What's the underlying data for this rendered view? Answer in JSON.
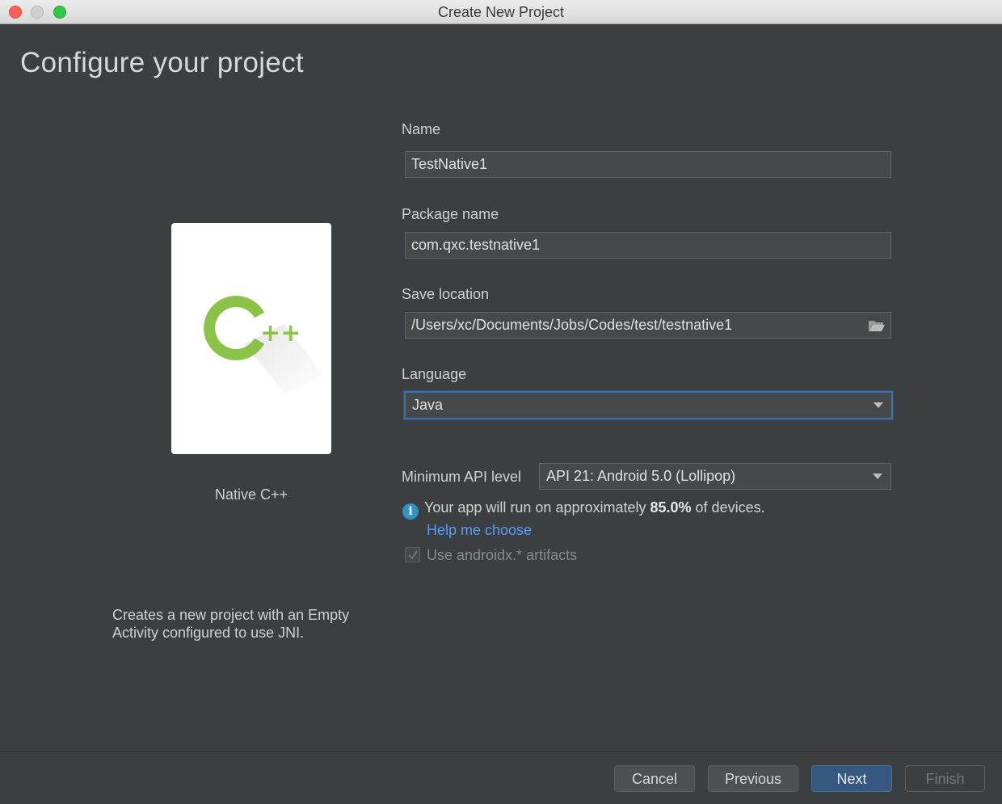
{
  "window": {
    "title": "Create New Project"
  },
  "page": {
    "title": "Configure your project"
  },
  "template": {
    "name": "Native C++",
    "description": "Creates a new project with an Empty Activity configured to use JNI.",
    "logo_text": "C++",
    "logo_color": "#8bc34a"
  },
  "form": {
    "name_label": "Name",
    "name_value": "TestNative1",
    "package_label": "Package name",
    "package_value": "com.qxc.testnative1",
    "location_label": "Save location",
    "location_value": "/Users/xc/Documents/Jobs/Codes/test/testnative1",
    "language_label": "Language",
    "language_value": "Java",
    "min_api_label": "Minimum API level",
    "min_api_value": "API 21: Android 5.0 (Lollipop)",
    "info_prefix": "Your app will run on approximately ",
    "info_percent": "85.0%",
    "info_suffix": " of devices.",
    "help_link": "Help me choose",
    "androidx_label": "Use androidx.* artifacts",
    "androidx_checked": true
  },
  "buttons": {
    "cancel": "Cancel",
    "previous": "Previous",
    "next": "Next",
    "finish": "Finish"
  },
  "colors": {
    "background": "#3c3f41",
    "accent": "#365880",
    "link": "#589df6",
    "focus_border": "#3d6fa8"
  }
}
